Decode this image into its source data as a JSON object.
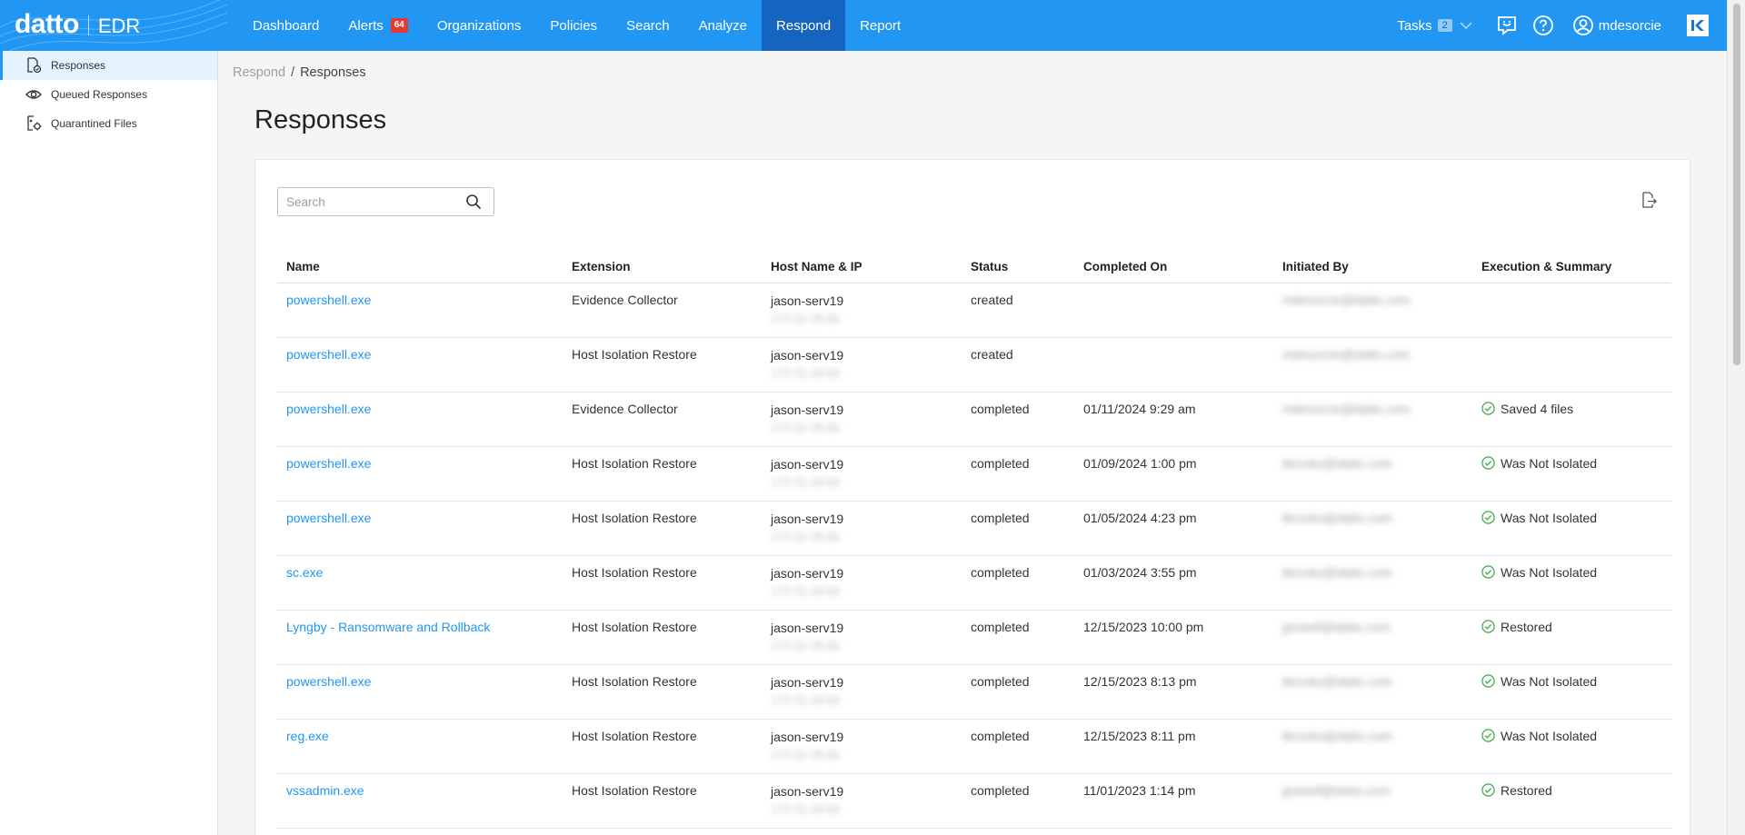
{
  "app": {
    "brand": "datto",
    "product": "EDR"
  },
  "nav": {
    "items": [
      {
        "label": "Dashboard"
      },
      {
        "label": "Alerts",
        "badge": "64"
      },
      {
        "label": "Organizations"
      },
      {
        "label": "Policies"
      },
      {
        "label": "Search"
      },
      {
        "label": "Analyze"
      },
      {
        "label": "Respond",
        "active": true
      },
      {
        "label": "Report"
      }
    ]
  },
  "toolbar": {
    "tasks_label": "Tasks",
    "tasks_count": "2",
    "user_name": "mdesorcie"
  },
  "sidebar": {
    "items": [
      {
        "label": "Responses",
        "icon": "response-file-icon",
        "active": true
      },
      {
        "label": "Queued Responses",
        "icon": "eye-icon"
      },
      {
        "label": "Quarantined Files",
        "icon": "quarantine-icon"
      }
    ]
  },
  "breadcrumb": {
    "parent": "Respond",
    "separator": "/",
    "current": "Responses"
  },
  "page": {
    "title": "Responses"
  },
  "search": {
    "placeholder": "Search",
    "value": ""
  },
  "table": {
    "columns": [
      "Name",
      "Extension",
      "Host Name & IP",
      "Status",
      "Completed On",
      "Initiated By",
      "Execution & Summary"
    ],
    "rows": [
      {
        "name": "powershell.exe",
        "extension": "Evidence Collector",
        "host": "jason-serv19",
        "ip": "172.31.28.66",
        "status": "created",
        "completed_on": "",
        "initiated_by": "mdesorcie@datto.com",
        "summary": ""
      },
      {
        "name": "powershell.exe",
        "extension": "Host Isolation Restore",
        "host": "jason-serv19",
        "ip": "172.31.28.66",
        "status": "created",
        "completed_on": "",
        "initiated_by": "mdesorcie@datto.com",
        "summary": ""
      },
      {
        "name": "powershell.exe",
        "extension": "Evidence Collector",
        "host": "jason-serv19",
        "ip": "172.31.28.66",
        "status": "completed",
        "completed_on": "01/11/2024 9:29 am",
        "initiated_by": "mdesorcie@datto.com",
        "summary": "Saved 4 files"
      },
      {
        "name": "powershell.exe",
        "extension": "Host Isolation Restore",
        "host": "jason-serv19",
        "ip": "172.31.28.66",
        "status": "completed",
        "completed_on": "01/09/2024 1:00 pm",
        "initiated_by": "lbrooks@datto.com",
        "summary": "Was Not Isolated"
      },
      {
        "name": "powershell.exe",
        "extension": "Host Isolation Restore",
        "host": "jason-serv19",
        "ip": "172.31.28.66",
        "status": "completed",
        "completed_on": "01/05/2024 4:23 pm",
        "initiated_by": "lbrooks@datto.com",
        "summary": "Was Not Isolated"
      },
      {
        "name": "sc.exe",
        "extension": "Host Isolation Restore",
        "host": "jason-serv19",
        "ip": "172.31.28.66",
        "status": "completed",
        "completed_on": "01/03/2024 3:55 pm",
        "initiated_by": "lbrooks@datto.com",
        "summary": "Was Not Isolated"
      },
      {
        "name": "Lyngby - Ransomware and Rollback",
        "extension": "Host Isolation Restore",
        "host": "jason-serv19",
        "ip": "172.31.28.66",
        "status": "completed",
        "completed_on": "12/15/2023 10:00 pm",
        "initiated_by": "jpowell@datto.com",
        "summary": "Restored"
      },
      {
        "name": "powershell.exe",
        "extension": "Host Isolation Restore",
        "host": "jason-serv19",
        "ip": "172.31.28.66",
        "status": "completed",
        "completed_on": "12/15/2023 8:13 pm",
        "initiated_by": "lbrooks@datto.com",
        "summary": "Was Not Isolated"
      },
      {
        "name": "reg.exe",
        "extension": "Host Isolation Restore",
        "host": "jason-serv19",
        "ip": "172.31.28.66",
        "status": "completed",
        "completed_on": "12/15/2023 8:11 pm",
        "initiated_by": "lbrooks@datto.com",
        "summary": "Was Not Isolated"
      },
      {
        "name": "vssadmin.exe",
        "extension": "Host Isolation Restore",
        "host": "jason-serv19",
        "ip": "172.31.28.66",
        "status": "completed",
        "completed_on": "11/01/2023 1:14 pm",
        "initiated_by": "jpowell@datto.com",
        "summary": "Restored"
      }
    ]
  },
  "colors": {
    "nav_bg": "#2196f3",
    "nav_active": "#1565c0",
    "link": "#2196f3",
    "success": "#4caf50",
    "alert_badge": "#e53935"
  }
}
